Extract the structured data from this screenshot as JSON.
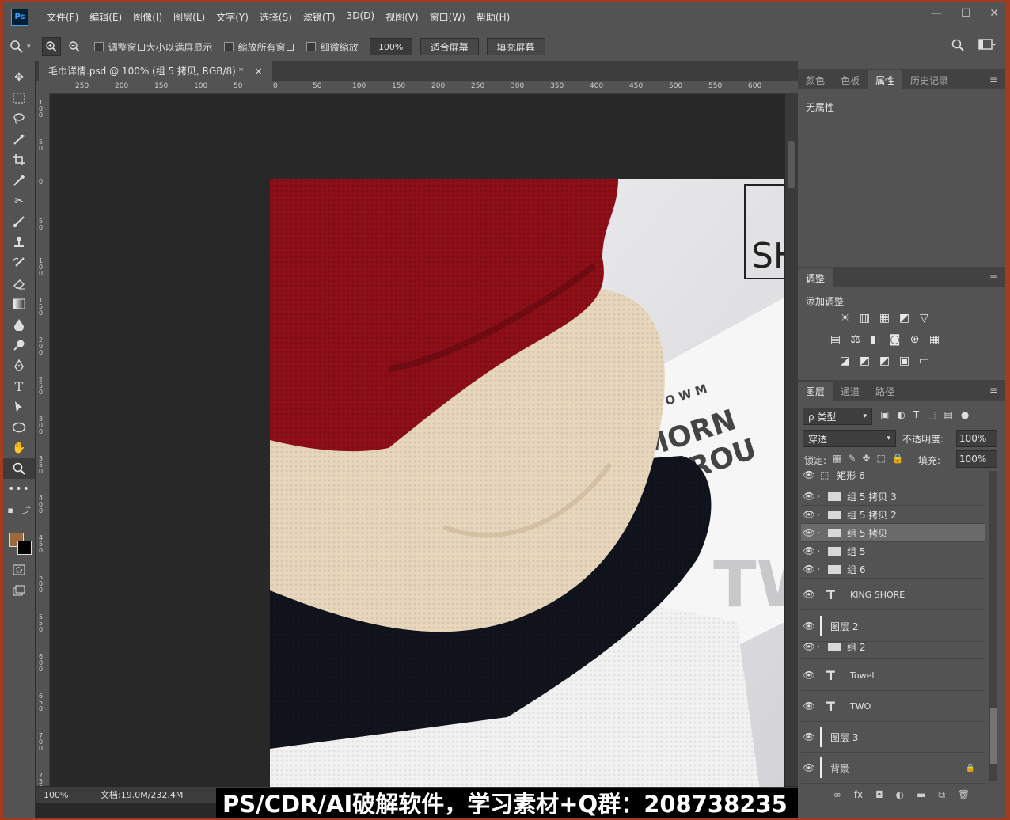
{
  "app": {
    "logo": "Ps",
    "menu": [
      "文件(F)",
      "编辑(E)",
      "图像(I)",
      "图层(L)",
      "文字(Y)",
      "选择(S)",
      "滤镜(T)",
      "3D(D)",
      "视图(V)",
      "窗口(W)",
      "帮助(H)"
    ],
    "window_controls": [
      "—",
      "☐",
      "✕"
    ]
  },
  "options": {
    "tool_icon": "zoom-icon",
    "check1": "调整窗口大小以满屏显示",
    "check2": "缩放所有窗口",
    "check3": "细微缩放",
    "zoom_value": "100%",
    "fit_label": "适合屏幕",
    "fill_label": "填充屏幕"
  },
  "document": {
    "tab_title": "毛巾详情.psd @ 100% (组 5 拷贝, RGB/8) *",
    "close": "×",
    "ruler_h": [
      "250",
      "200",
      "150",
      "100",
      "50",
      "0",
      "50",
      "100",
      "150",
      "200",
      "250",
      "300",
      "350",
      "400",
      "450",
      "500",
      "550",
      "600"
    ],
    "ruler_v": [
      "100",
      "50",
      "0",
      "50",
      "100",
      "150",
      "200",
      "250",
      "300",
      "350",
      "400",
      "450",
      "500",
      "550",
      "600",
      "650",
      "700",
      "750"
    ],
    "artboard_text": "SH",
    "zoom_status": "100%",
    "doc_status": "文档:19.0M/232.4M"
  },
  "watermark": "PS/CDR/AI破解软件，学习素材+Q群：208738235",
  "properties_panel": {
    "tabs": [
      "颜色",
      "色板",
      "属性",
      "历史记录"
    ],
    "active_tab": "属性",
    "empty_text": "无属性"
  },
  "adjustments_panel": {
    "tab": "调整",
    "title": "添加调整"
  },
  "layers_panel": {
    "tabs": [
      "图层",
      "通道",
      "路径"
    ],
    "filter_label": "ρ 类型",
    "blend_mode": "穿透",
    "opacity_label": "不透明度:",
    "opacity_value": "100%",
    "lock_label": "锁定:",
    "fill_label": "填充:",
    "fill_value": "100%",
    "layers": [
      {
        "name": "矩形 6",
        "kind": "shape"
      },
      {
        "name": "组 5 拷贝 3",
        "kind": "group"
      },
      {
        "name": "组 5 拷贝 2",
        "kind": "group"
      },
      {
        "name": "组 5 拷贝",
        "kind": "group",
        "selected": true
      },
      {
        "name": "组 5",
        "kind": "group"
      },
      {
        "name": "组 6",
        "kind": "group"
      },
      {
        "name": "KING SHORE",
        "kind": "text"
      },
      {
        "name": "图层 2",
        "kind": "pixel"
      },
      {
        "name": "组 2",
        "kind": "group"
      },
      {
        "name": "Towel",
        "kind": "text"
      },
      {
        "name": "TWO",
        "kind": "text"
      },
      {
        "name": "图层 3",
        "kind": "pixel"
      },
      {
        "name": "背景",
        "kind": "pixel",
        "locked": true
      }
    ],
    "footer_icons": [
      "link-icon",
      "fx-icon",
      "mask-icon",
      "adjustment-icon",
      "group-icon",
      "new-layer-icon",
      "trash-icon"
    ],
    "footer_glyphs": [
      "∞",
      "fx",
      "◘",
      "◐",
      "▬",
      "⧉",
      "🗑"
    ]
  },
  "colors": {
    "foreground": "#9a6a3a",
    "background": "#000000",
    "towel_red": "#8e0f18",
    "towel_beige": "#e8d7bd",
    "towel_navy": "#11131d"
  }
}
